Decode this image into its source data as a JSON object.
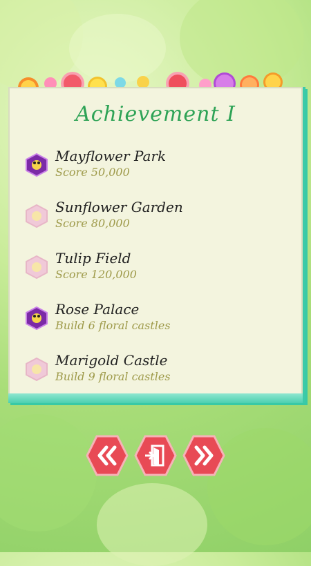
{
  "title": "Achievement I",
  "achievements": [
    {
      "name": "Mayflower Park",
      "desc": "Score 50,000",
      "unlocked": true
    },
    {
      "name": "Sunflower Garden",
      "desc": "Score 80,000",
      "unlocked": false
    },
    {
      "name": "Tulip Field",
      "desc": "Score 120,000",
      "unlocked": false
    },
    {
      "name": "Rose Palace",
      "desc": "Build 6 floral castles",
      "unlocked": true
    },
    {
      "name": "Marigold Castle",
      "desc": "Build 9 floral castles",
      "unlocked": false
    }
  ],
  "buttons": {
    "prev": "prev-page",
    "exit": "exit",
    "next": "next-page"
  },
  "colors": {
    "accent": "#2ea356",
    "button": "#e84a55",
    "panel": "#f3f4de",
    "teal": "#3ccaa8"
  }
}
